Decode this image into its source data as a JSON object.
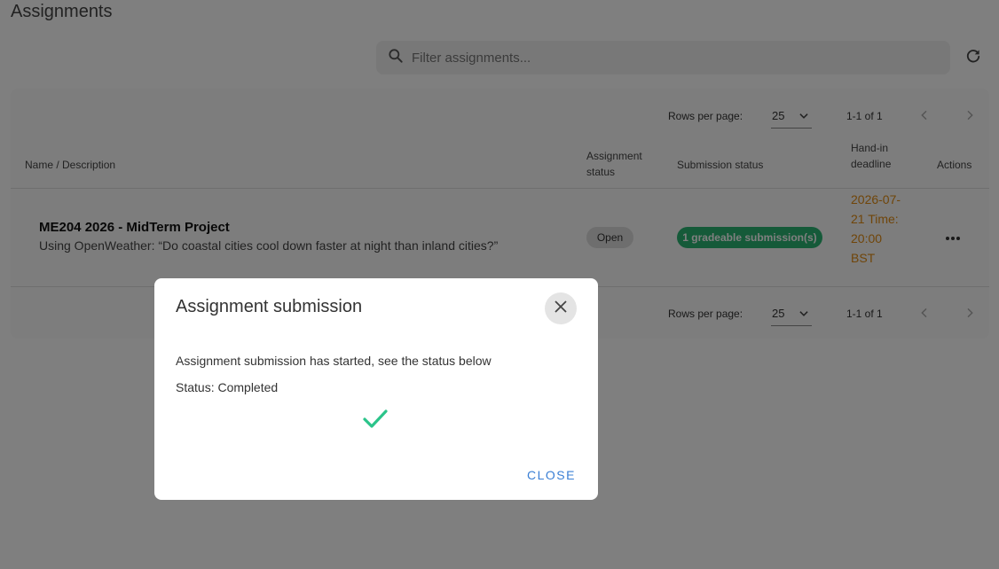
{
  "page": {
    "title": "Assignments",
    "search_placeholder": "Filter assignments..."
  },
  "icons": {
    "search": "search-icon",
    "refresh": "refresh-icon",
    "chevron_down": "chevron-down-icon",
    "chevron_left": "chevron-left-icon",
    "chevron_right": "chevron-right-icon",
    "more": "more-horizontal-icon",
    "close": "close-icon",
    "check": "check-icon"
  },
  "pagination": {
    "rows_per_page_label": "Rows per page:",
    "rows_per_page_value": "25",
    "range": "1-1 of 1"
  },
  "table": {
    "headers": {
      "name": "Name / Description",
      "assignment_status": "Assignment status",
      "submission_status": "Submission status",
      "deadline": "Hand-in deadline",
      "actions": "Actions"
    },
    "rows": [
      {
        "title": "ME204 2026 - MidTerm Project",
        "description": "Using OpenWeather: “Do coastal cities cool down faster at night than inland cities?”",
        "assignment_status": "Open",
        "submission_status": "1 gradeable submission(s)",
        "deadline": "2026-07-21 Time: 20:00 BST"
      }
    ]
  },
  "dialog": {
    "title": "Assignment submission",
    "message": "Assignment submission has started, see the status below",
    "status": "Status: Completed",
    "close_label": "CLOSE"
  },
  "colors": {
    "submission_chip": "#2bb573",
    "deadline_text": "#e08b12",
    "check": "#2bc48a",
    "dialog_button": "#3a7fd5",
    "overlay": "rgba(0,0,0,0.5)"
  }
}
